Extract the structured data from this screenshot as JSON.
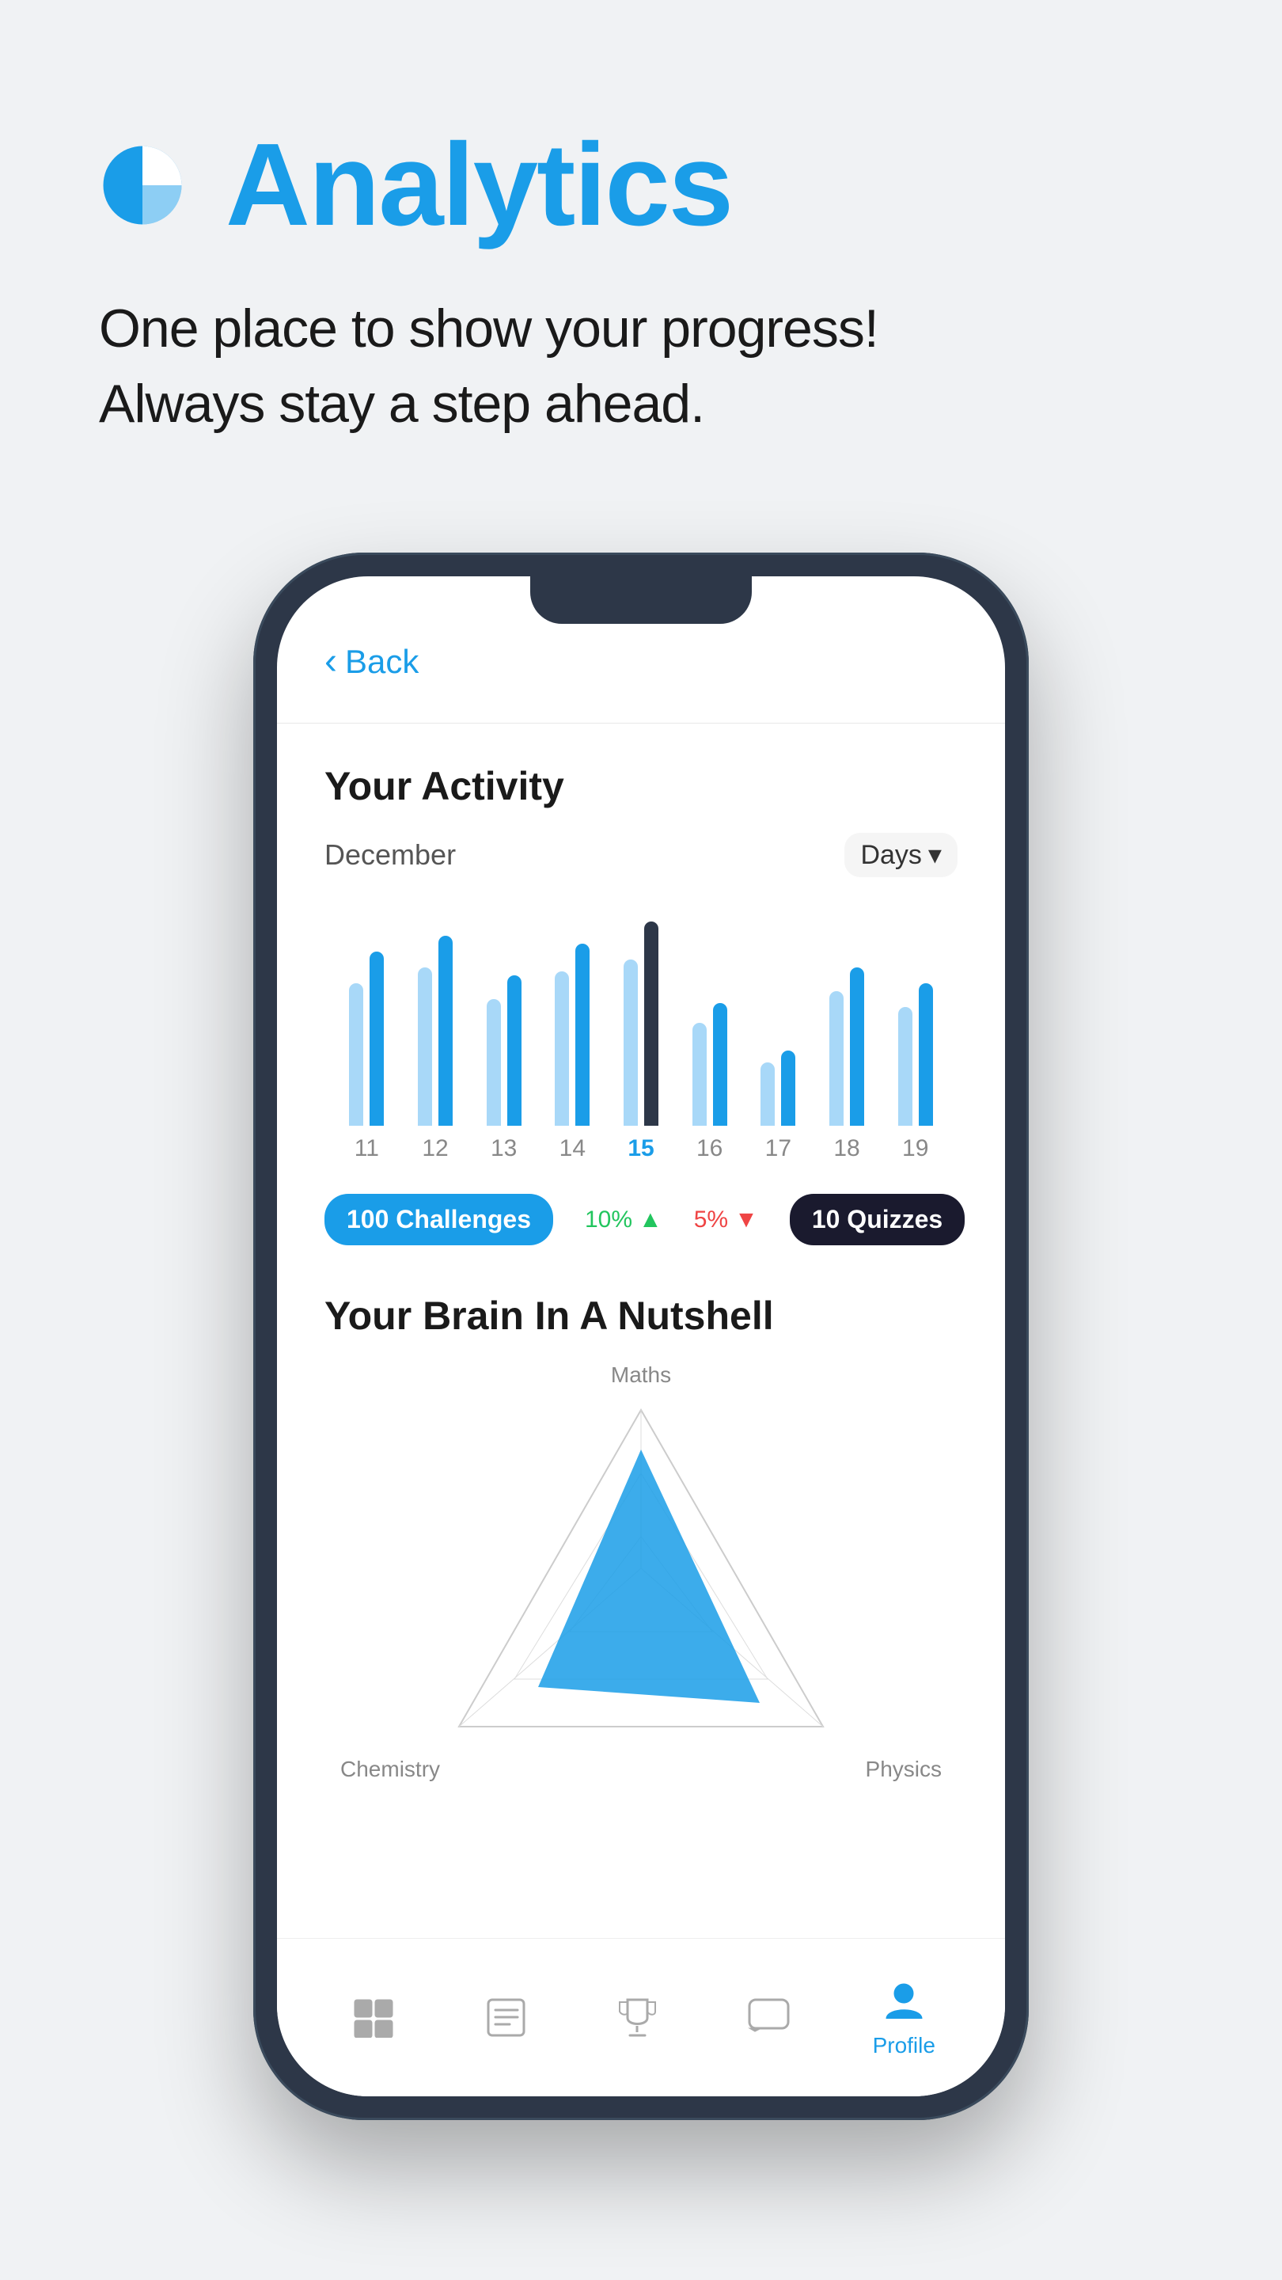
{
  "header": {
    "icon_label": "analytics-chart-icon",
    "title": "Analytics",
    "subtitle_line1": "One place to show your progress!",
    "subtitle_line2": "Always stay a step ahead."
  },
  "phone": {
    "back_button": "Back",
    "screen": {
      "activity_section": {
        "title": "Your Activity",
        "month": "December",
        "period_selector": "Days",
        "bar_labels": [
          "11",
          "12",
          "13",
          "14",
          "15",
          "16",
          "17",
          "18",
          "19"
        ],
        "selected_bar": "15",
        "stats": {
          "challenges_count": "100",
          "challenges_label": "Challenges",
          "stat1_value": "10%",
          "stat1_direction": "up",
          "stat2_value": "5%",
          "stat2_direction": "down",
          "quizzes_count": "10",
          "quizzes_label": "Quizzes"
        }
      },
      "brain_section": {
        "title": "Your Brain In A Nutshell",
        "radar_labels": {
          "top": "Maths",
          "bottom_left": "Chemistry",
          "bottom_right": "Physics"
        }
      },
      "tab_bar": {
        "tabs": [
          {
            "name": "home",
            "label": "",
            "active": false
          },
          {
            "name": "courses",
            "label": "",
            "active": false
          },
          {
            "name": "trophy",
            "label": "",
            "active": false
          },
          {
            "name": "messages",
            "label": "",
            "active": false
          },
          {
            "name": "profile",
            "label": "Profile",
            "active": true
          }
        ]
      }
    }
  },
  "colors": {
    "primary_blue": "#1a9de8",
    "dark": "#2d3748",
    "text_dark": "#1a1a1a",
    "text_gray": "#888888",
    "background": "#f0f2f4"
  }
}
